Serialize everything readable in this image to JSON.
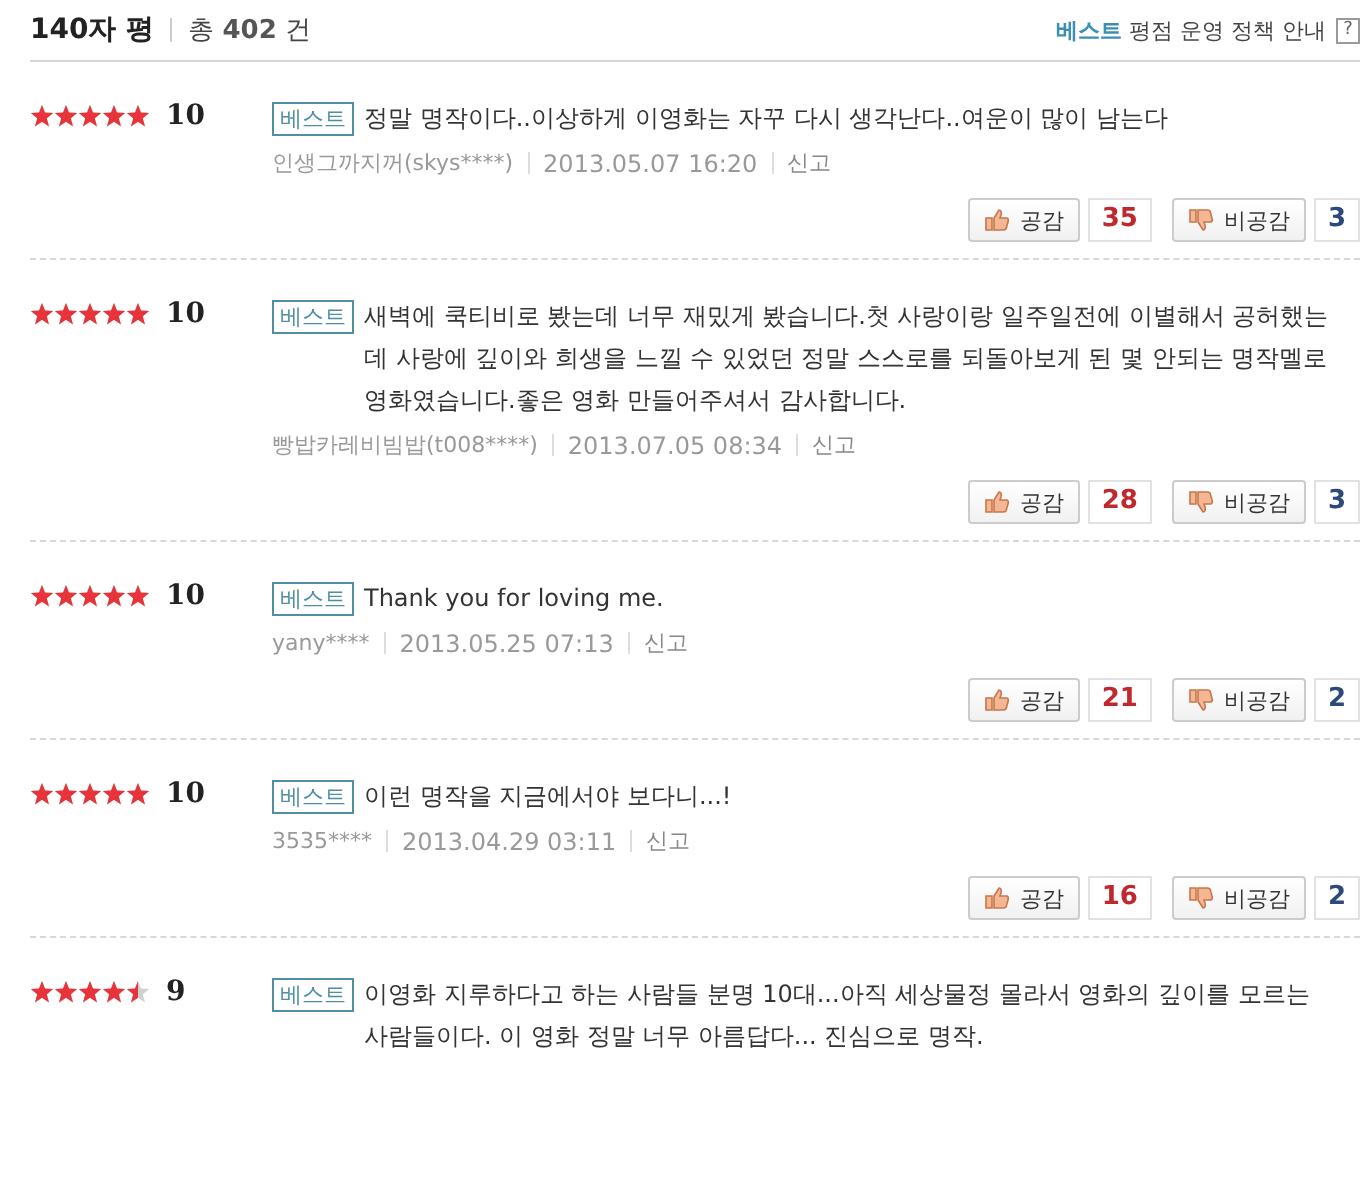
{
  "header": {
    "title": "140자 평",
    "total_prefix": "총",
    "total_count": "402",
    "total_suffix": "건",
    "policy_highlight": "베스트",
    "policy_text": "평점 운영 정책 안내",
    "help": "?"
  },
  "reviews": [
    {
      "stars": 5,
      "score": "10",
      "badge": "베스트",
      "text": "정말 명작이다..이상하게 이영화는 자꾸 다시 생각난다..여운이 많이 남는다",
      "author": "인생그까지꺼(skys****)",
      "date": "2013.05.07 16:20",
      "report": "신고",
      "like_label": "공감",
      "likes": "35",
      "dislike_label": "비공감",
      "dislikes": "3"
    },
    {
      "stars": 5,
      "score": "10",
      "badge": "베스트",
      "text": "새벽에 쿡티비로 봤는데 너무 재밌게 봤습니다.첫 사랑이랑 일주일전에 이별해서 공허했는데 사랑에 깊이와 희생을 느낄 수 있었던 정말 스스로를 되돌아보게 된 몇 안되는 명작멜로 영화였습니다.좋은 영화 만들어주셔서 감사합니다.",
      "author": "빵밥카레비빔밥(t008****)",
      "date": "2013.07.05 08:34",
      "report": "신고",
      "like_label": "공감",
      "likes": "28",
      "dislike_label": "비공감",
      "dislikes": "3"
    },
    {
      "stars": 5,
      "score": "10",
      "badge": "베스트",
      "text": "Thank you for loving me.",
      "author": "yany****",
      "date": "2013.05.25 07:13",
      "report": "신고",
      "like_label": "공감",
      "likes": "21",
      "dislike_label": "비공감",
      "dislikes": "2"
    },
    {
      "stars": 5,
      "score": "10",
      "badge": "베스트",
      "text": "이런 명작을 지금에서야 보다니...!",
      "author": "3535****",
      "date": "2013.04.29 03:11",
      "report": "신고",
      "like_label": "공감",
      "likes": "16",
      "dislike_label": "비공감",
      "dislikes": "2"
    },
    {
      "stars": 4.5,
      "score": "9",
      "badge": "베스트",
      "text": "이영화 지루하다고 하는 사람들 분명 10대...아직 세상물정 몰라서 영화의 깊이를 모르는 사람들이다. 이 영화 정말 너무 아름답다... 진심으로 명작."
    }
  ]
}
